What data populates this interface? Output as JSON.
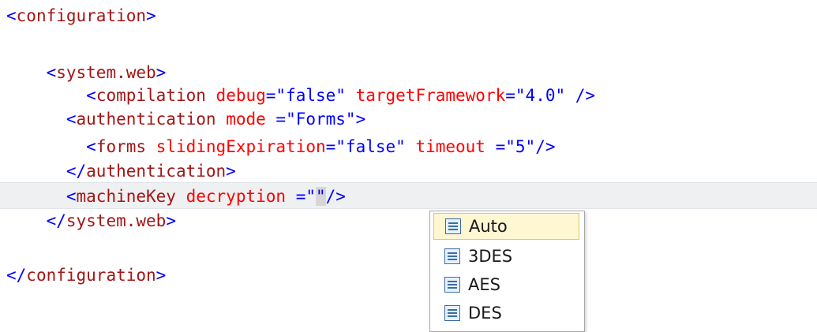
{
  "editor": {
    "lines": [
      {
        "indent": "",
        "parts": [
          {
            "cls": "brk",
            "t": "<"
          },
          {
            "cls": "tag",
            "t": "configuration"
          },
          {
            "cls": "brk",
            "t": ">"
          }
        ]
      },
      {
        "indent": "",
        "parts": []
      },
      {
        "indent": "    ",
        "parts": [
          {
            "cls": "brk",
            "t": "<"
          },
          {
            "cls": "tag",
            "t": "system.web"
          },
          {
            "cls": "brk",
            "t": ">"
          }
        ]
      },
      {
        "indent": "        ",
        "parts": [
          {
            "cls": "brk",
            "t": "<"
          },
          {
            "cls": "tag",
            "t": "compilation"
          },
          {
            "cls": "txt",
            "t": " "
          },
          {
            "cls": "attr",
            "t": "debug"
          },
          {
            "cls": "brk",
            "t": "="
          },
          {
            "cls": "val",
            "t": "\"false\""
          },
          {
            "cls": "txt",
            "t": " "
          },
          {
            "cls": "attr",
            "t": "targetFramework"
          },
          {
            "cls": "brk",
            "t": "="
          },
          {
            "cls": "val",
            "t": "\"4.0\""
          },
          {
            "cls": "brk",
            "t": " />"
          }
        ]
      },
      {
        "indent": "      ",
        "parts": [
          {
            "cls": "brk",
            "t": "<"
          },
          {
            "cls": "tag",
            "t": "authentication"
          },
          {
            "cls": "txt",
            "t": " "
          },
          {
            "cls": "attr",
            "t": "mode"
          },
          {
            "cls": "brk",
            "t": " ="
          },
          {
            "cls": "val",
            "t": "\"Forms\""
          },
          {
            "cls": "brk",
            "t": ">"
          }
        ]
      },
      {
        "indent": "        ",
        "parts": [
          {
            "cls": "brk",
            "t": "<"
          },
          {
            "cls": "tag",
            "t": "forms"
          },
          {
            "cls": "txt",
            "t": " "
          },
          {
            "cls": "attr",
            "t": "slidingExpiration"
          },
          {
            "cls": "brk",
            "t": "="
          },
          {
            "cls": "val",
            "t": "\"false\""
          },
          {
            "cls": "txt",
            "t": " "
          },
          {
            "cls": "attr",
            "t": "timeout"
          },
          {
            "cls": "brk",
            "t": " ="
          },
          {
            "cls": "val",
            "t": "\"5\""
          },
          {
            "cls": "brk",
            "t": "/>"
          }
        ]
      },
      {
        "indent": "      ",
        "parts": [
          {
            "cls": "brk",
            "t": "</"
          },
          {
            "cls": "tag",
            "t": "authentication"
          },
          {
            "cls": "brk",
            "t": ">"
          }
        ]
      },
      {
        "indent": "      ",
        "current": true,
        "parts": [
          {
            "cls": "brk",
            "t": "<"
          },
          {
            "cls": "tag",
            "t": "machineKey"
          },
          {
            "cls": "txt",
            "t": " "
          },
          {
            "cls": "attr",
            "t": "decryption"
          },
          {
            "cls": "brk",
            "t": " ="
          },
          {
            "cls": "val",
            "t": "\""
          },
          {
            "cls": "val empty-val-highlight",
            "t": "\""
          },
          {
            "cls": "brk",
            "t": "/>"
          }
        ]
      },
      {
        "indent": "    ",
        "parts": [
          {
            "cls": "brk",
            "t": "</"
          },
          {
            "cls": "tag",
            "t": "system.web"
          },
          {
            "cls": "brk",
            "t": ">"
          }
        ]
      },
      {
        "indent": "",
        "parts": []
      },
      {
        "indent": "",
        "parts": [
          {
            "cls": "brk",
            "t": "</"
          },
          {
            "cls": "tag",
            "t": "configuration"
          },
          {
            "cls": "brk",
            "t": ">"
          }
        ]
      }
    ]
  },
  "completion": {
    "items": [
      {
        "label": "Auto",
        "icon": "enum-value-icon",
        "selected": true
      },
      {
        "label": "3DES",
        "icon": "enum-value-icon",
        "selected": false
      },
      {
        "label": "AES",
        "icon": "enum-value-icon",
        "selected": false
      },
      {
        "label": "DES",
        "icon": "enum-value-icon",
        "selected": false
      }
    ]
  }
}
